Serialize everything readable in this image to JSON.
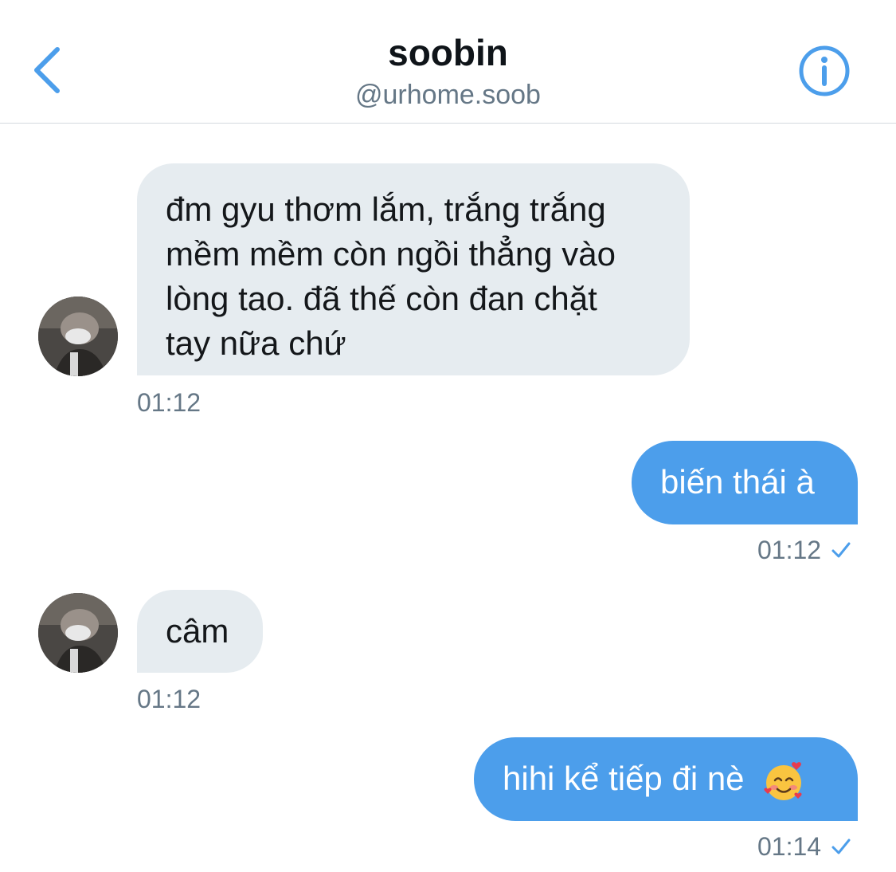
{
  "header": {
    "name": "soobin",
    "handle": "@urhome.soob",
    "back_icon": "chevron-left-icon",
    "info_icon": "info-icon",
    "accent_color": "#4c9eeb"
  },
  "messages": [
    {
      "direction": "incoming",
      "lines": [
        "đm gyu thơm lắm, trắng trắng",
        "mềm mềm còn ngồi thẳng vào",
        "lòng tao. đã thế còn đan chặt",
        "tay nữa chứ"
      ],
      "time": "01:12"
    },
    {
      "direction": "outgoing",
      "text": "biến thái à",
      "time": "01:12",
      "status_icon": "check-icon"
    },
    {
      "direction": "incoming",
      "text": "câm",
      "time": "01:12"
    },
    {
      "direction": "outgoing",
      "text": "hihi kể tiếp đi nè",
      "emoji": "smiling-face-with-hearts",
      "time": "01:14",
      "status_icon": "check-icon"
    }
  ],
  "colors": {
    "incoming_bubble": "#e6ecf0",
    "outgoing_bubble": "#4c9eeb",
    "timestamp": "#657786"
  }
}
